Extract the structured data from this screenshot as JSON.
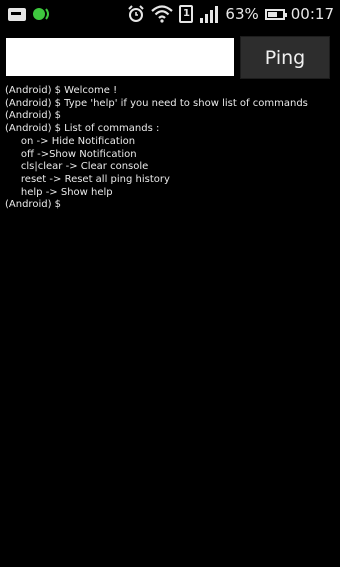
{
  "status_bar": {
    "icons_left": [
      "mail-icon",
      "notification-dot-icon"
    ],
    "icons_right": [
      "alarm-clock-icon",
      "wifi-icon",
      "sim-card-icon",
      "signal-bars-icon",
      "battery-icon"
    ],
    "sim_label": "1",
    "battery_percent": "63%",
    "battery_level": 0.63,
    "time": "00:17",
    "accent_green": "#3ec83e"
  },
  "toolbar": {
    "input_value": "",
    "ping_label": "Ping"
  },
  "console": {
    "lines": [
      "(Android) $ Welcome !",
      "(Android) $ Type 'help' if you need to show list of commands",
      "(Android) $",
      "(Android) $ List of commands :",
      "     on -> Hide Notification",
      "     off ->Show Notification",
      "     cls|clear -> Clear console",
      "     reset -> Reset all ping history",
      "     help -> Show help",
      "(Android) $"
    ]
  }
}
